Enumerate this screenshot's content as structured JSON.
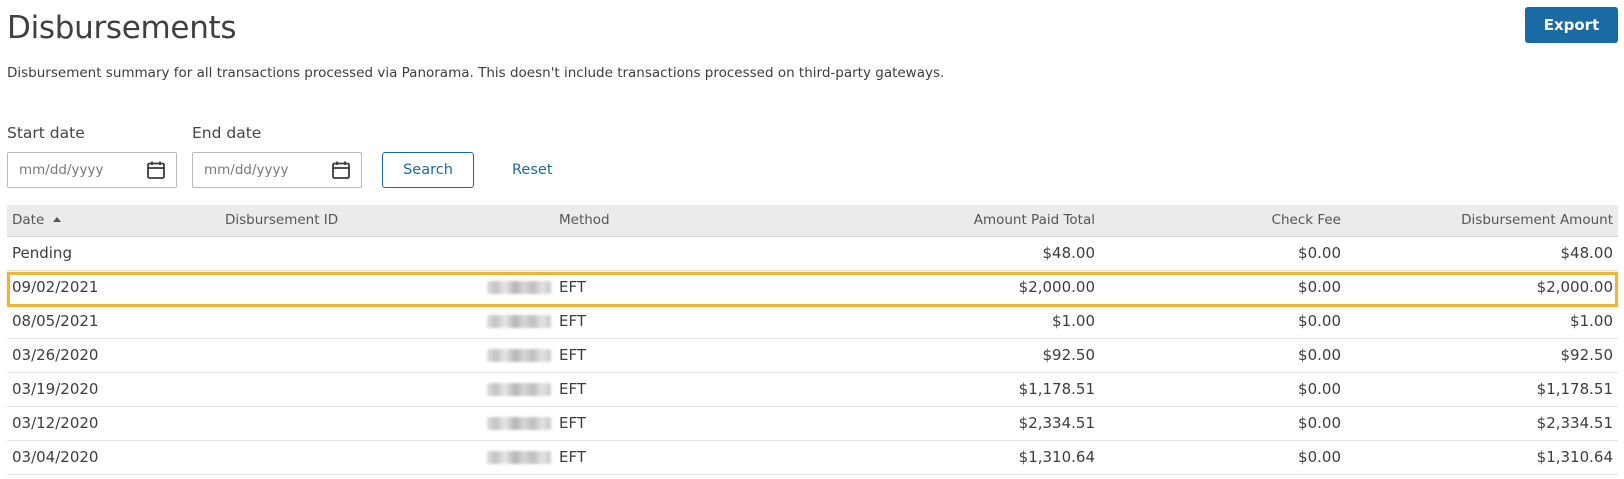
{
  "header": {
    "title": "Disbursements",
    "export_label": "Export",
    "description": "Disbursement summary for all transactions processed via Panorama. This doesn't include transactions processed on third-party gateways."
  },
  "filters": {
    "start_label": "Start date",
    "start_placeholder": "mm/dd/yyyy",
    "end_label": "End date",
    "end_placeholder": "mm/dd/yyyy",
    "search_label": "Search",
    "reset_label": "Reset"
  },
  "table": {
    "columns": {
      "date": "Date",
      "id": "Disbursement ID",
      "method": "Method",
      "amount_paid": "Amount Paid Total",
      "check_fee": "Check Fee",
      "disbursement_amount": "Disbursement Amount"
    },
    "sort": {
      "column": "date",
      "direction": "ascending"
    },
    "rows": [
      {
        "date": "Pending",
        "id_redacted": false,
        "method": "",
        "amount_paid": "$48.00",
        "check_fee": "$0.00",
        "disbursement_amount": "$48.00",
        "highlighted": false
      },
      {
        "date": "09/02/2021",
        "id_redacted": true,
        "method": "EFT",
        "amount_paid": "$2,000.00",
        "check_fee": "$0.00",
        "disbursement_amount": "$2,000.00",
        "highlighted": true
      },
      {
        "date": "08/05/2021",
        "id_redacted": true,
        "method": "EFT",
        "amount_paid": "$1.00",
        "check_fee": "$0.00",
        "disbursement_amount": "$1.00",
        "highlighted": false
      },
      {
        "date": "03/26/2020",
        "id_redacted": true,
        "method": "EFT",
        "amount_paid": "$92.50",
        "check_fee": "$0.00",
        "disbursement_amount": "$92.50",
        "highlighted": false
      },
      {
        "date": "03/19/2020",
        "id_redacted": true,
        "method": "EFT",
        "amount_paid": "$1,178.51",
        "check_fee": "$0.00",
        "disbursement_amount": "$1,178.51",
        "highlighted": false
      },
      {
        "date": "03/12/2020",
        "id_redacted": true,
        "method": "EFT",
        "amount_paid": "$2,334.51",
        "check_fee": "$0.00",
        "disbursement_amount": "$2,334.51",
        "highlighted": false
      },
      {
        "date": "03/04/2020",
        "id_redacted": true,
        "method": "EFT",
        "amount_paid": "$1,310.64",
        "check_fee": "$0.00",
        "disbursement_amount": "$1,310.64",
        "highlighted": false
      }
    ]
  },
  "icons": {
    "calendar": "calendar-icon",
    "sort": "sort-ascending-icon"
  },
  "colors": {
    "accent": "#1a6aa3",
    "highlight": "#eab63b",
    "header_bg": "#ebebeb"
  }
}
